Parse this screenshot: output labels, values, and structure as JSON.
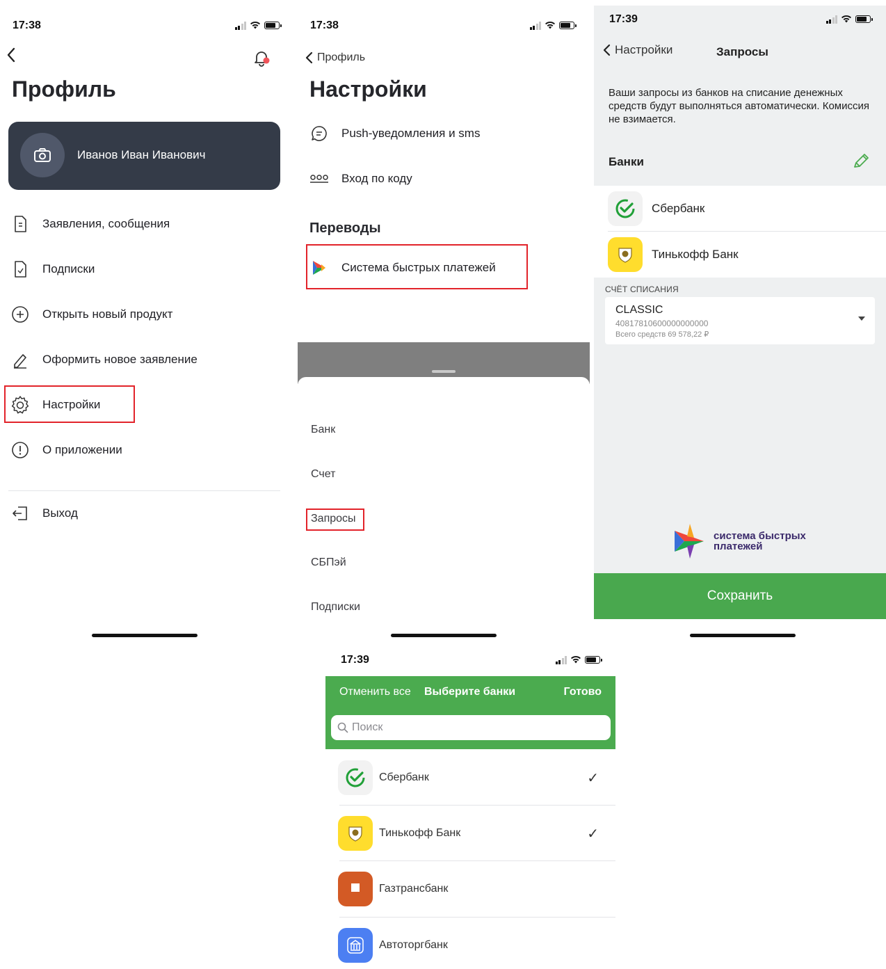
{
  "status_bar": {
    "p1_time": "17:38",
    "p2_time": "17:38",
    "p3_time": "17:39",
    "p4_time": "17:39"
  },
  "profile": {
    "title": "Профиль",
    "user_name": "Иванов Иван Иванович",
    "menu": [
      {
        "label": "Заявления, сообщения",
        "icon": "document-icon"
      },
      {
        "label": "Подписки",
        "icon": "subscription-doc-icon"
      },
      {
        "label": "Открыть новый продукт",
        "icon": "plus-circle-icon"
      },
      {
        "label": "Оформить новое заявление",
        "icon": "pencil-icon"
      },
      {
        "label": "Настройки",
        "icon": "gear-icon"
      },
      {
        "label": "О приложении",
        "icon": "info-icon"
      }
    ],
    "logout_label": "Выход"
  },
  "settings": {
    "back_label": "Профиль",
    "title": "Настройки",
    "items": [
      {
        "label": "Push-уведомления и sms",
        "icon": "chat-icon"
      },
      {
        "label": "Вход по коду",
        "icon": "pin-code-icon"
      }
    ],
    "transfers_heading": "Переводы",
    "sbp_label": "Система быстрых платежей",
    "sheet_items": [
      "Банк",
      "Счет",
      "Запросы",
      "СБПэй",
      "Подписки"
    ]
  },
  "requests": {
    "back_label": "Настройки",
    "title": "Запросы",
    "info": "Ваши запросы из банков на списание денежных средств будут выполняться автоматически. Комиссия не взимается.",
    "banks_heading": "Банки",
    "banks": [
      "Сбербанк",
      "Тинькофф Банк"
    ],
    "account_label": "СЧЁТ СПИСАНИЯ",
    "account_name": "CLASSIC",
    "account_number": "40817810600000000000",
    "account_balance": "Всего средств 69 578,22 ₽",
    "sbp_brand": [
      "система быстрых",
      "платежей"
    ],
    "save_label": "Сохранить"
  },
  "bank_picker": {
    "cancel_label": "Отменить все",
    "title": "Выберите банки",
    "done_label": "Готово",
    "search_placeholder": "Поиск",
    "banks": [
      {
        "name": "Сбербанк",
        "checked": true
      },
      {
        "name": "Тинькофф Банк",
        "checked": true
      },
      {
        "name": "Газтрансбанк",
        "checked": false
      },
      {
        "name": "Автоторгбанк",
        "checked": false
      }
    ],
    "check_glyph": "✓"
  },
  "colors": {
    "accent_green": "#4bab4f",
    "highlight_red": "#e2232a",
    "profile_card": "#343b48",
    "sber_green": "#21a038",
    "tinkoff_yellow": "#ffdd2d",
    "gaztrans_orange": "#d35a25",
    "avtotorg_blue": "#4c7ff2"
  }
}
